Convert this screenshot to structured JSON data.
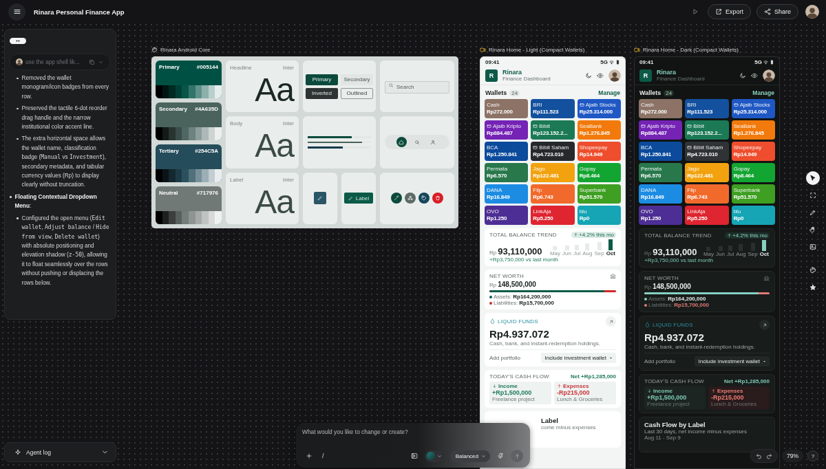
{
  "app_bar": {
    "title": "Rinara Personal Finance App",
    "actions": [
      {
        "label": "Export",
        "kind": "export"
      },
      {
        "label": "Share",
        "kind": "share"
      }
    ]
  },
  "chat": {
    "prompt_preview": "use the app shell lik...",
    "notes": [
      {
        "children": [
          {
            "parts": [
              {
                "text": "Removed the wallet monogram/icon badges from every row."
              }
            ]
          },
          {
            "parts": [
              {
                "text": "Preserved the tactile 6-dot reorder drag handle and the narrow institutional color accent line."
              }
            ]
          },
          {
            "parts": [
              {
                "text": "The extra horizontal space allows the wallet name, classification badge ("
              },
              {
                "text": "Manual",
                "mono": true
              },
              {
                "text": " vs "
              },
              {
                "text": "Investment",
                "mono": true
              },
              {
                "text": "), secondary metadata, and tabular currency values (Rp) to display clearly without truncation."
              }
            ]
          }
        ]
      },
      {
        "parts": [
          {
            "text": "**Floating Contextual Dropdown Menu**:"
          }
        ],
        "children": [
          {
            "parts": [
              {
                "text": "Configured the open menu ("
              },
              {
                "text": "Edit wallet",
                "mono": true
              },
              {
                "text": ", "
              },
              {
                "text": "Adjust balance",
                "mono": true
              },
              {
                "text": " / "
              },
              {
                "text": "Hide from view",
                "mono": true
              },
              {
                "text": ", "
              },
              {
                "text": "Delete wallet",
                "mono": true
              },
              {
                "text": ") with absolute positioning and elevation shadow ("
              },
              {
                "text": "z-50",
                "mono": true
              },
              {
                "text": "), allowing it to float seamlessly over the rows without pushing or displacing the rows below."
              }
            ]
          }
        ]
      }
    ]
  },
  "agent_log": {
    "label": "Agent log"
  },
  "canvas": {
    "frames": [
      {
        "kind": "design_system",
        "title": "Rinara Android Core",
        "palettes": [
          {
            "name": "Primary",
            "hex": "#005144",
            "color": "#005144"
          },
          {
            "name": "Secondary",
            "hex": "#4A635D",
            "color": "#4a635d"
          },
          {
            "name": "Tertiary",
            "hex": "#254C5A",
            "color": "#254c5a"
          },
          {
            "name": "Neutral",
            "hex": "#717976",
            "color": "#717976"
          }
        ],
        "type_styles": [
          {
            "role": "Headline",
            "font": "Inter",
            "sample": "Aa"
          },
          {
            "role": "Body",
            "font": "Inter",
            "sample": "Aa"
          },
          {
            "role": "Label",
            "font": "Inter",
            "sample": "Aa"
          }
        ],
        "buttons": [
          {
            "label": "Primary",
            "kind": "primary"
          },
          {
            "label": "Secondary",
            "kind": "secondary"
          },
          {
            "label": "Inverted",
            "kind": "inverted"
          },
          {
            "label": "Outlined",
            "kind": "outlined"
          }
        ],
        "search_placeholder": "Search",
        "progress": [
          {
            "level": 0.7,
            "color": "#0b4a3c"
          },
          {
            "level": 0.86,
            "color": "#4a635d"
          },
          {
            "level": 0.55,
            "color": "#10394a"
          }
        ],
        "nav_items": [
          {
            "kind": "home",
            "selected": true
          },
          {
            "kind": "search",
            "selected": false
          },
          {
            "kind": "person",
            "selected": false
          }
        ],
        "chip_button": "Label",
        "fabs": [
          {
            "kind": "wand",
            "color": "#0b4a3c"
          },
          {
            "kind": "nodes",
            "color": "#5e6a66"
          },
          {
            "kind": "tag",
            "color": "#15465a"
          },
          {
            "kind": "trash",
            "color": "#d81e27"
          }
        ]
      },
      {
        "kind": "phone_light",
        "title": "Rinara Home - Light (Compact Wallets)",
        "phone": {
          "time": "09:41",
          "network": "5G",
          "logo": "R",
          "brand": "Rinara",
          "subtitle": "Finance Dashboard",
          "wallets_title": "Wallets",
          "wallet_count": "24",
          "manage": "Manage",
          "wallets": [
            {
              "name": "Cash",
              "amount": "Rp272.000",
              "color": "#8c7366",
              "has_icon": false
            },
            {
              "name": "BRI",
              "amount": "Rp111.523",
              "color": "#13519f",
              "has_icon": false
            },
            {
              "name": "Ajaib Stocks",
              "amount": "Rp25.314.000",
              "color": "#1f58c4",
              "has_icon": true
            },
            {
              "name": "Ajaib Kripto",
              "amount": "Rp884.487",
              "color": "#7423b5",
              "has_icon": true
            },
            {
              "name": "Bibit",
              "amount": "Rp123.152.2...",
              "color": "#1b7a55",
              "has_icon": true
            },
            {
              "name": "SeaBank",
              "amount": "Rp1.276.845",
              "color": "#f27a0c",
              "has_icon": false
            },
            {
              "name": "BCA",
              "amount": "Rp1.250.841",
              "color": "#0c4b9c",
              "has_icon": false
            },
            {
              "name": "Bibit Saham",
              "amount": "Rp4.723.010",
              "color": "#26292c",
              "has_icon": true
            },
            {
              "name": "Shopeepay",
              "amount": "Rp14.949",
              "color": "#ee4e2e",
              "has_icon": false
            },
            {
              "name": "Permata",
              "amount": "Rp6.570",
              "color": "#28784c",
              "has_icon": false
            },
            {
              "name": "Jago",
              "amount": "Rp122.481",
              "color": "#f2a20f",
              "has_icon": false
            },
            {
              "name": "Gopay",
              "amount": "Rp8.464",
              "color": "#13a532",
              "has_icon": false
            },
            {
              "name": "DANA",
              "amount": "Rp16.849",
              "color": "#1c8ce3",
              "has_icon": false
            },
            {
              "name": "Flip",
              "amount": "Rp6.743",
              "color": "#f16a2b",
              "has_icon": false
            },
            {
              "name": "Superbank",
              "amount": "Rp51.570",
              "color": "#3e9f22",
              "has_icon": false
            },
            {
              "name": "OVO",
              "amount": "Rp1.250",
              "color": "#4d2e94",
              "has_icon": false
            },
            {
              "name": "LinkAja",
              "amount": "Rp5.250",
              "color": "#de2530",
              "has_icon": false
            },
            {
              "name": "blu",
              "amount": "Rp0",
              "color": "#15a5b5",
              "has_icon": false
            }
          ],
          "trend": {
            "label": "TOTAL BALANCE TREND",
            "change": "+4.2% this mo",
            "currency": "Rp",
            "total": "93,110,000",
            "delta": "+Rp3,750,000 vs last month",
            "months": [
              {
                "label": "May",
                "selected": false
              },
              {
                "label": "Jun",
                "selected": false
              },
              {
                "label": "Jul",
                "selected": false
              },
              {
                "label": "Aug",
                "selected": false
              },
              {
                "label": "Sep",
                "selected": false
              },
              {
                "label": "Oct",
                "selected": true
              }
            ]
          },
          "net_worth": {
            "label": "NET WORTH",
            "currency": "Rp",
            "total": "148,500,000",
            "level": 0.91,
            "assets_label": "Assets:",
            "assets": "Rp164,200,000",
            "liabilities_label": "Liabilities:",
            "liabilities": "Rp15,700,000"
          },
          "liquid": {
            "label": "LIQUID FUNDS",
            "amount": "Rp4.937.072",
            "description": "Cash, bank, and instant-redemption holdings.",
            "portfolio_label": "Add portfolio",
            "portfolio_choice": "Include investment wallet"
          },
          "cash_flow": {
            "label": "TODAY'S CASH FLOW",
            "net": "Net +Rp1,285,000",
            "entries": [
              {
                "kind": "income",
                "label": "Income",
                "amount": "+Rp1,500,000",
                "note": "Freelance project"
              },
              {
                "kind": "expense",
                "label": "Expenses",
                "amount": "-Rp215,000",
                "note": "Lunch & Groceries"
              }
            ]
          },
          "label_card": {
            "kind": "partial",
            "title": "Label",
            "subtitle": "come minus expenses"
          }
        }
      },
      {
        "kind": "phone_dark",
        "title": "Rinara Home - Dark (Compact Wallets)",
        "phone": {
          "time": "09:41",
          "network": "5G",
          "logo": "R",
          "brand": "Rinara",
          "subtitle": "Finance Dashboard",
          "wallets_title": "Wallets",
          "wallet_count": "24",
          "manage": "Manage",
          "wallets": [
            {
              "name": "Cash",
              "amount": "Rp272.000",
              "color": "#8c7366",
              "has_icon": false
            },
            {
              "name": "BRI",
              "amount": "Rp111.523",
              "color": "#13519f",
              "has_icon": false
            },
            {
              "name": "Ajaib Stocks",
              "amount": "Rp25.314.000",
              "color": "#1f58c4",
              "has_icon": true
            },
            {
              "name": "Ajaib Kripto",
              "amount": "Rp884.487",
              "color": "#7423b5",
              "has_icon": true
            },
            {
              "name": "Bibit",
              "amount": "Rp123.152.2...",
              "color": "#1b7a55",
              "has_icon": true
            },
            {
              "name": "SeaBank",
              "amount": "Rp1.276.845",
              "color": "#f27a0c",
              "has_icon": false
            },
            {
              "name": "BCA",
              "amount": "Rp1.250.841",
              "color": "#0c4b9c",
              "has_icon": false
            },
            {
              "name": "Bibit Saham",
              "amount": "Rp4.723.010",
              "color": "#2f3336",
              "has_icon": true
            },
            {
              "name": "Shopeepay",
              "amount": "Rp14.949",
              "color": "#ee4e2e",
              "has_icon": false
            },
            {
              "name": "Permata",
              "amount": "Rp6.570",
              "color": "#28784c",
              "has_icon": false
            },
            {
              "name": "Jago",
              "amount": "Rp122.481",
              "color": "#f2a20f",
              "has_icon": false
            },
            {
              "name": "Gopay",
              "amount": "Rp8.464",
              "color": "#13a532",
              "has_icon": false
            },
            {
              "name": "DANA",
              "amount": "Rp16.849",
              "color": "#1c8ce3",
              "has_icon": false
            },
            {
              "name": "Flip",
              "amount": "Rp6.743",
              "color": "#f16a2b",
              "has_icon": false
            },
            {
              "name": "Superbank",
              "amount": "Rp51.570",
              "color": "#3e9f22",
              "has_icon": false
            },
            {
              "name": "OVO",
              "amount": "Rp1.250",
              "color": "#4d2e94",
              "has_icon": false
            },
            {
              "name": "LinkAja",
              "amount": "Rp5.250",
              "color": "#de2530",
              "has_icon": false
            },
            {
              "name": "blu",
              "amount": "Rp0",
              "color": "#15a5b5",
              "has_icon": false
            }
          ],
          "trend": {
            "label": "TOTAL BALANCE TREND",
            "change": "+4.2% this mo",
            "currency": "Rp",
            "total": "93,110,000",
            "delta": "+Rp3,750,000 vs last month",
            "months": [
              {
                "label": "May",
                "selected": false
              },
              {
                "label": "Jun",
                "selected": false
              },
              {
                "label": "Jul",
                "selected": false
              },
              {
                "label": "Aug",
                "selected": false
              },
              {
                "label": "Sep",
                "selected": false
              },
              {
                "label": "Oct",
                "selected": true
              }
            ]
          },
          "net_worth": {
            "label": "NET WORTH",
            "currency": "Rp",
            "total": "148,500,000",
            "level": 0.91,
            "assets_label": "Assets:",
            "assets": "Rp164,200,000",
            "liabilities_label": "Liabilities:",
            "liabilities": "Rp15,700,000"
          },
          "liquid": {
            "label": "LIQUID FUNDS",
            "amount": "Rp4.937.072",
            "description": "Cash, bank, and instant-redemption holdings.",
            "portfolio_label": "Add portfolio",
            "portfolio_choice": "Include investment wallet"
          },
          "cash_flow": {
            "label": "TODAY'S CASH FLOW",
            "net": "Net +Rp1,285,000",
            "entries": [
              {
                "kind": "income",
                "label": "Income",
                "amount": "+Rp1,500,000",
                "note": "Freelance project"
              },
              {
                "kind": "expense",
                "label": "Expenses",
                "amount": "-Rp215,000",
                "note": "Lunch & Groceries"
              }
            ]
          },
          "label_card": {
            "kind": "full",
            "title": "Cash Flow by Label",
            "subtitle": "Last 30 days, net income minus expenses",
            "dates": "Aug 11 - Sep 9"
          }
        }
      }
    ]
  },
  "composer": {
    "placeholder": "What would you like to change or create?",
    "slash": "/",
    "mode": "Balanced"
  },
  "tools": [
    {
      "kind": "pointer",
      "selected": true
    },
    {
      "kind": "frame",
      "selected": false
    },
    {
      "kind": "pen",
      "selected": false
    },
    {
      "kind": "hand",
      "selected": false
    },
    {
      "kind": "image",
      "selected": false
    },
    {
      "kind": "palette",
      "selected": false
    },
    {
      "kind": "star",
      "selected": false
    }
  ],
  "zoom": {
    "level_text": "79%",
    "help": "?"
  }
}
